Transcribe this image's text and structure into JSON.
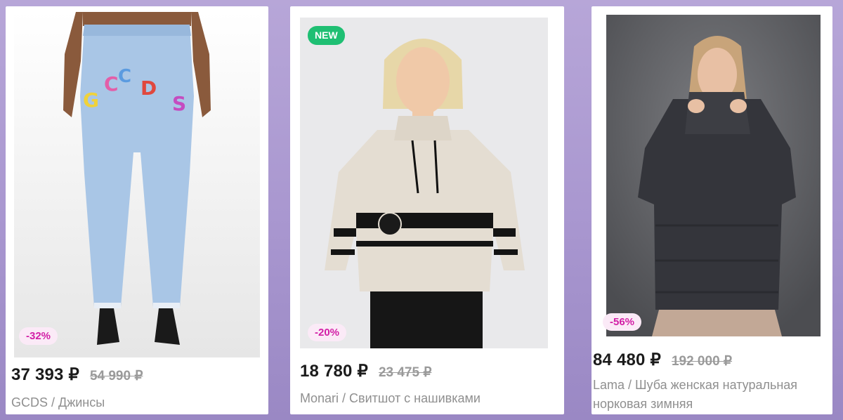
{
  "products": [
    {
      "badge": "-32%",
      "price": "37 393 ₽",
      "old_price": "54 990 ₽",
      "title": "GCDS / Джинсы"
    },
    {
      "new_badge": "NEW",
      "badge": "-20%",
      "price": "18 780 ₽",
      "old_price": "23 475 ₽",
      "title": "Monari / Свитшот с нашивками"
    },
    {
      "badge": "-56%",
      "price": "84 480 ₽",
      "old_price": "192 000 ₽",
      "title_line1": "Lama / Шуба женская натуральная",
      "title_line2": "норковая зимняя"
    }
  ],
  "colors": {
    "discount_badge_bg": "#fbeaf7",
    "discount_badge_text": "#d21fa6",
    "new_badge_bg": "#1fbf73",
    "price_text": "#1b1b1b",
    "old_price_text": "#9a9a9a",
    "title_text": "#8f8f8f"
  }
}
